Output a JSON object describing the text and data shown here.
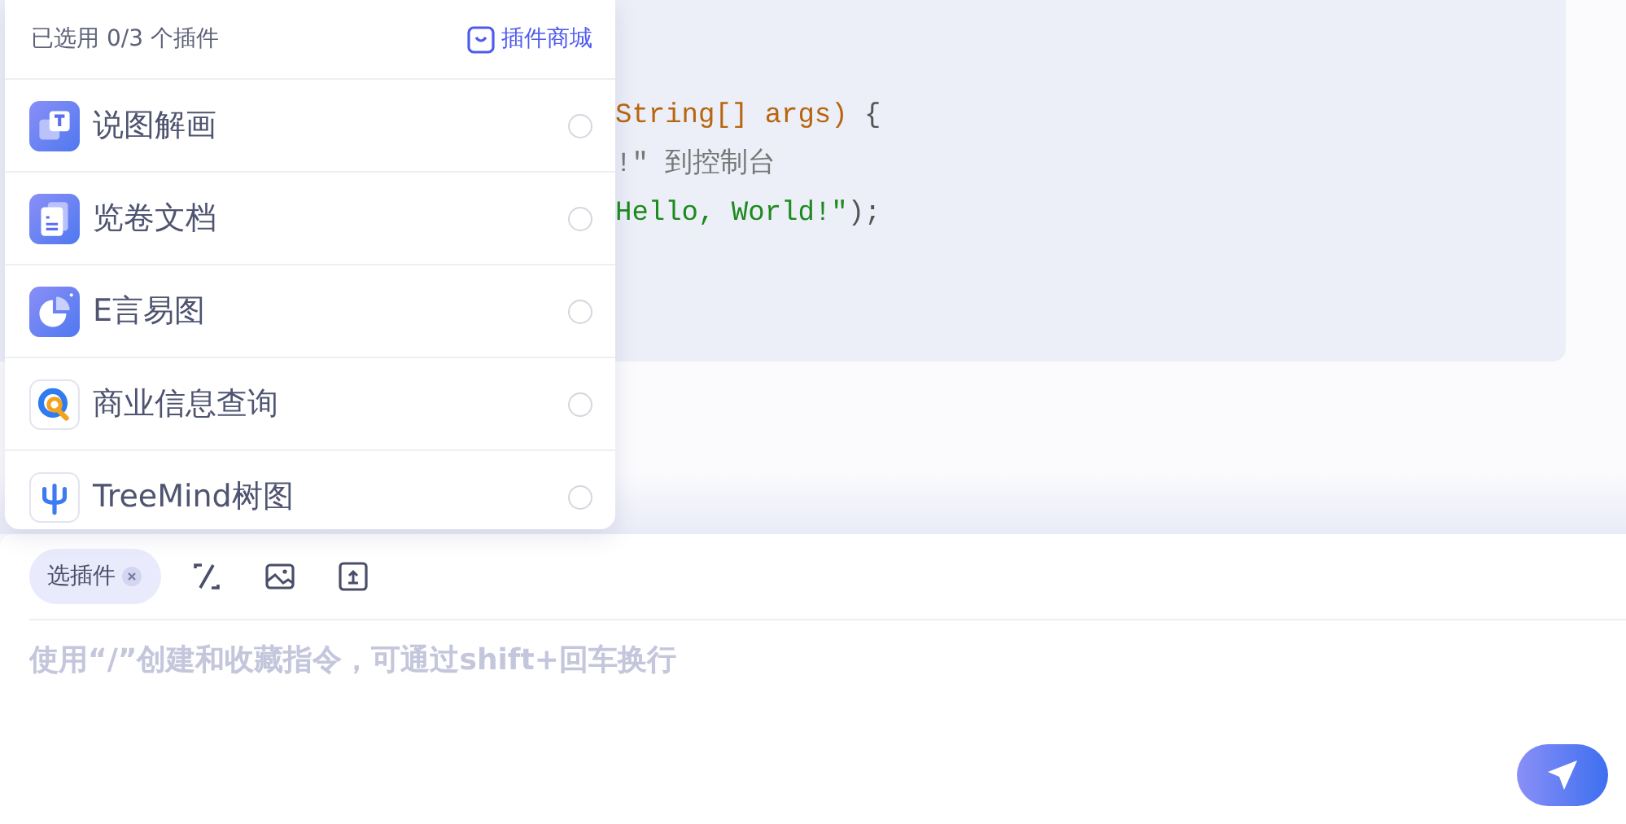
{
  "code_block": {
    "lines": [
      {
        "tokens": [
          {
            "kind": "type",
            "text": "String[] args)"
          },
          {
            "kind": "plain",
            "text": " {"
          }
        ]
      },
      {
        "tokens": [
          {
            "kind": "comment",
            "text": "!\" 到控制台"
          }
        ]
      },
      {
        "tokens": [
          {
            "kind": "string",
            "text": "Hello, World!\""
          },
          {
            "kind": "plain",
            "text": ");"
          }
        ]
      }
    ]
  },
  "plugin_popup": {
    "summary": "已选用 0/3 个插件",
    "store_link": "插件商城",
    "plugins": [
      {
        "name": "说图解画",
        "selected": false
      },
      {
        "name": "览卷文档",
        "selected": false
      },
      {
        "name": "E言易图",
        "selected": false
      },
      {
        "name": "商业信息查询",
        "selected": false
      },
      {
        "name": "TreeMind树图",
        "selected": false
      }
    ]
  },
  "composer": {
    "plugin_chip": "选插件",
    "placeholder": "使用“/”创建和收藏指令，可通过shift+回车换行"
  }
}
